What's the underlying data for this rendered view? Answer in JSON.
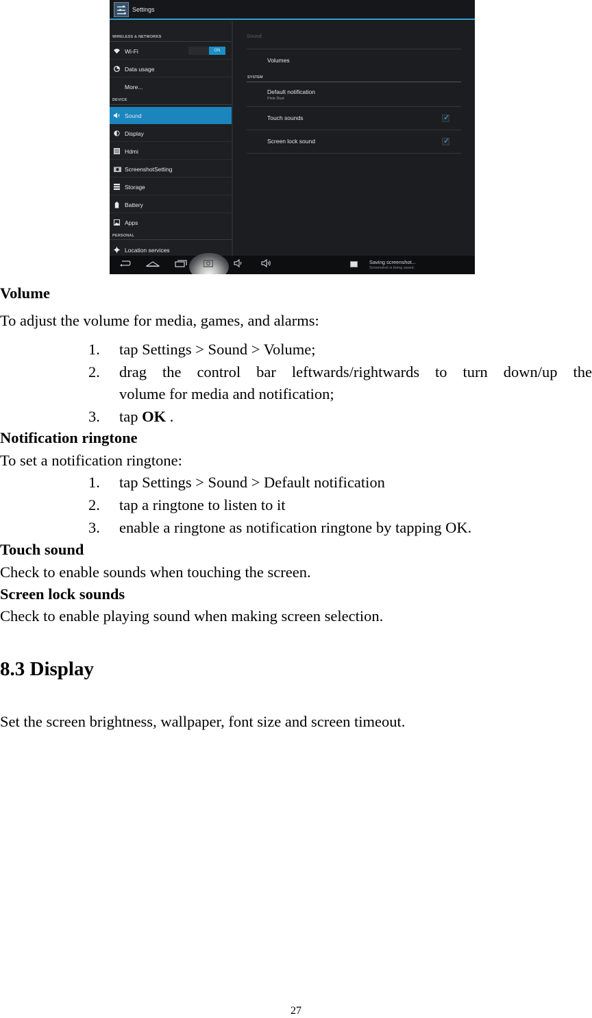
{
  "screenshot": {
    "app_title": "Settings",
    "left_pane": {
      "categories": [
        "WIRELESS & NETWORKS",
        "DEVICE",
        "PERSONAL"
      ],
      "items": [
        {
          "label": "Wi-Fi",
          "icon": "wifi-icon",
          "toggle": "ON"
        },
        {
          "label": "Data usage",
          "icon": "data-usage-icon"
        },
        {
          "label": "More...",
          "icon": ""
        },
        {
          "label": "Sound",
          "icon": "sound-icon",
          "selected": true
        },
        {
          "label": "Display",
          "icon": "display-icon"
        },
        {
          "label": "Hdmi",
          "icon": "hdmi-icon"
        },
        {
          "label": "ScreenshotSetting",
          "icon": "camera-icon"
        },
        {
          "label": "Storage",
          "icon": "storage-icon"
        },
        {
          "label": "Battery",
          "icon": "battery-icon"
        },
        {
          "label": "Apps",
          "icon": "apps-icon"
        },
        {
          "label": "Location services",
          "icon": "location-icon"
        }
      ]
    },
    "right_pane": {
      "title": "Sound",
      "volumes_label": "Volumes",
      "system_category": "SYSTEM",
      "default_notification": {
        "label": "Default notification",
        "value": "Pixie Dust"
      },
      "touch_sounds": {
        "label": "Touch sounds",
        "checked": true
      },
      "screen_lock_sound": {
        "label": "Screen lock sound",
        "checked": true
      }
    },
    "navbar": {
      "notification_title": "Saving screenshot...",
      "notification_sub": "Screenshot is being saved."
    },
    "colors": {
      "accent": "#1b86bd",
      "check": "#39b4e8",
      "background": "#1c1d20"
    }
  },
  "doc": {
    "volume": {
      "heading": "Volume",
      "intro": "To adjust the volume for media, games, and alarms:",
      "steps": [
        {
          "num": "1.",
          "text": "tap Settings > Sound > Volume;"
        },
        {
          "num": "2.",
          "text_line1": "drag the control bar leftwards/rightwards to turn down/up the",
          "text_line2": "volume for media and notification;"
        },
        {
          "num": "3.",
          "text_pre": "tap ",
          "text_bold": "OK",
          "text_post": " ."
        }
      ]
    },
    "notification": {
      "heading": "Notification ringtone",
      "intro": "To set a notification ringtone:",
      "steps": [
        {
          "num": "1.",
          "text": "tap Settings > Sound > Default notification"
        },
        {
          "num": "2.",
          "text": "tap a ringtone to listen to it"
        },
        {
          "num": "3.",
          "text": "enable a ringtone as notification ringtone by tapping OK."
        }
      ]
    },
    "touch_sound": {
      "heading": "Touch sound",
      "text": "Check to enable sounds when touching the screen."
    },
    "screen_lock": {
      "heading": "Screen lock sounds",
      "text": "Check to enable playing sound when making screen selection."
    },
    "display": {
      "heading": "8.3 Display",
      "text": "Set the screen brightness, wallpaper, font size and screen timeout."
    },
    "page_number": "27"
  }
}
